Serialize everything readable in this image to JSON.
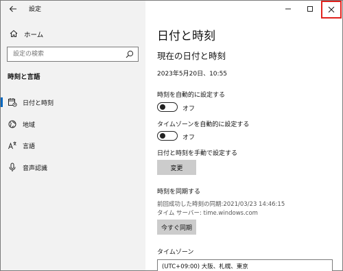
{
  "app": {
    "title": "設定"
  },
  "sidebar": {
    "home_label": "ホーム",
    "search_placeholder": "設定の検索",
    "section_title": "時刻と言語",
    "items": [
      {
        "label": "日付と時刻",
        "icon": "calendar-icon",
        "active": true
      },
      {
        "label": "地域",
        "icon": "globe-icon",
        "active": false
      },
      {
        "label": "言語",
        "icon": "language-icon",
        "active": false
      },
      {
        "label": "音声認識",
        "icon": "microphone-icon",
        "active": false
      }
    ]
  },
  "main": {
    "page_title": "日付と時刻",
    "subhead": "現在の日付と時刻",
    "current_datetime": "2023年5月20日、10:55",
    "auto_time": {
      "label": "時刻を自動的に設定する",
      "state": "オフ"
    },
    "auto_timezone": {
      "label": "タイムゾーンを自動的に設定する",
      "state": "オフ"
    },
    "manual": {
      "label": "日付と時刻を手動で設定する",
      "button": "変更"
    },
    "sync": {
      "label": "時刻を同期する",
      "last_sync": "前回成功した時刻の同期:2021/03/23 14:46:15",
      "server": "タイム サーバー: time.windows.com",
      "button": "今すぐ同期"
    },
    "timezone": {
      "label": "タイムゾーン",
      "value": "(UTC+09:00) 大阪、札幌、東京"
    }
  },
  "colors": {
    "accent": "#0067c0",
    "highlight": "#e0201b",
    "sidebar_bg": "#f2f2f2",
    "button_bg": "#cccccc"
  }
}
